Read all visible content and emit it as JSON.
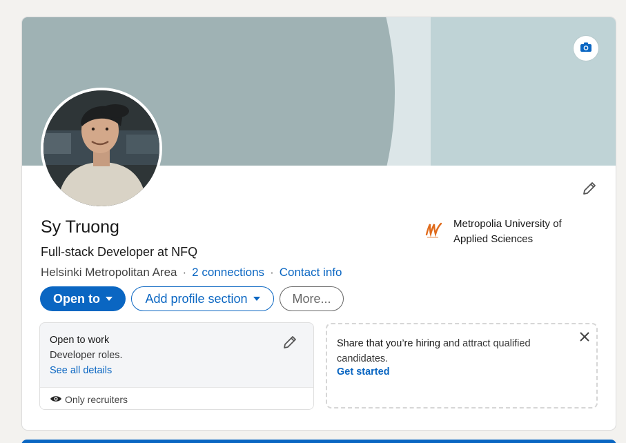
{
  "profile": {
    "name": "Sy Truong",
    "headline": "Full-stack Developer at NFQ",
    "location": "Helsinki Metropolitan Area",
    "connections": "2 connections",
    "contact": "Contact info",
    "separator": "·"
  },
  "education": {
    "school": "Metropolia University of Applied Sciences"
  },
  "actions": {
    "open_to": "Open to",
    "add_section": "Add profile section",
    "more": "More..."
  },
  "open_to_work": {
    "title": "Open to work",
    "description": "Developer roles.",
    "details_link": "See all details",
    "visibility": "Only recruiters"
  },
  "hiring": {
    "bold": "Share that you’re hiring",
    "rest": " and attract qualified candidates.",
    "cta": "Get started"
  },
  "icons": {
    "camera": "camera-icon",
    "edit": "pencil-icon",
    "eye": "eye-icon",
    "close": "close-icon",
    "caret": "caret-down-icon"
  },
  "colors": {
    "accent": "#0a66c2",
    "background": "#f3f2ef",
    "banner": "#9fb2b4"
  }
}
